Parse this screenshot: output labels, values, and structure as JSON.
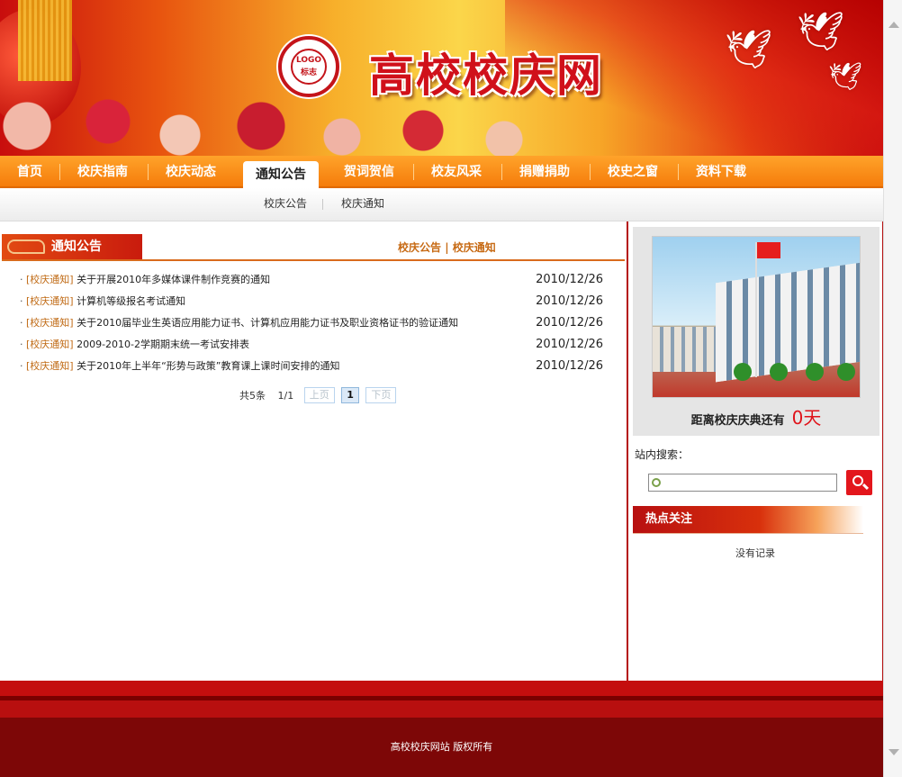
{
  "header": {
    "site_title": "高校校庆网",
    "logo": {
      "top": "LOGO",
      "bottom": "标志"
    }
  },
  "nav": {
    "items": [
      "首页",
      "校庆指南",
      "校庆动态",
      "通知公告",
      "贺词贺信",
      "校友风采",
      "捐赠捐助",
      "校史之窗",
      "资料下载"
    ],
    "active": "通知公告"
  },
  "subnav": {
    "items": [
      "校庆公告",
      "校庆通知"
    ]
  },
  "section": {
    "title": "通知公告",
    "links": [
      "校庆公告",
      "校庆通知"
    ],
    "separator": "|"
  },
  "list": [
    {
      "cat": "[校庆通知]",
      "title": "关于开展2010年多媒体课件制作竞赛的通知",
      "date": "2010/12/26"
    },
    {
      "cat": "[校庆通知]",
      "title": "计算机等级报名考试通知",
      "date": "2010/12/26"
    },
    {
      "cat": "[校庆通知]",
      "title": "关于2010届毕业生英语应用能力证书、计算机应用能力证书及职业资格证书的验证通知",
      "date": "2010/12/26"
    },
    {
      "cat": "[校庆通知]",
      "title": "2009-2010-2学期期末统一考试安排表",
      "date": "2010/12/26"
    },
    {
      "cat": "[校庆通知]",
      "title": "关于2010年上半年“形势与政策”教育课上课时间安排的通知",
      "date": "2010/12/26"
    }
  ],
  "pager": {
    "total": "共5条",
    "pages": "1/1",
    "prev": "上页",
    "current": "1",
    "next": "下页"
  },
  "sidebar": {
    "countdown_label": "距离校庆庆典还有",
    "countdown_value": "0天",
    "search_label": "站内搜索：",
    "search_value": "",
    "hot_title": "热点关注",
    "no_record": "没有记录"
  },
  "footer": {
    "text": "高校校庆网站  版权所有"
  },
  "colors": {
    "primary_red": "#c40e0e",
    "nav_orange": "#f57c0b",
    "link_orange": "#c06a14",
    "footer_dark": "#7d0707"
  }
}
